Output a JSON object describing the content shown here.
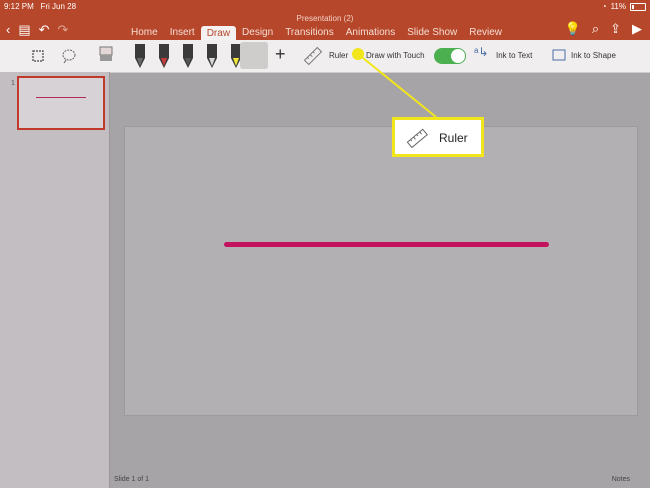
{
  "status": {
    "time": "9:12 PM",
    "date": "Fri Jun 28",
    "battery": "11%"
  },
  "ribbon": {
    "doc_title": "Presentation (2)",
    "tabs": [
      {
        "label": "Home"
      },
      {
        "label": "Insert"
      },
      {
        "label": "Draw",
        "active": true
      },
      {
        "label": "Design"
      },
      {
        "label": "Transitions"
      },
      {
        "label": "Animations"
      },
      {
        "label": "Slide Show"
      },
      {
        "label": "Review"
      }
    ]
  },
  "toolbar": {
    "ruler_label": "Ruler",
    "draw_touch_label": "Draw with Touch",
    "draw_touch_on": true,
    "ink_to_text_label": "Ink to Text",
    "ink_to_shape_label": "Ink to Shape",
    "pen_colors": [
      "#6a6a6a",
      "#c93a3a",
      "#555555",
      "#d7d7d7",
      "#f1e83a",
      "#c21766"
    ],
    "accent": "#b7472a"
  },
  "sidebar": {
    "slide_number": "1"
  },
  "slide": {
    "stroke_color": "#c4135d"
  },
  "footer": {
    "slide_status": "Slide 1 of 1",
    "notes": "Notes"
  },
  "callout": {
    "label": "Ruler",
    "color": "#f2e61b"
  }
}
